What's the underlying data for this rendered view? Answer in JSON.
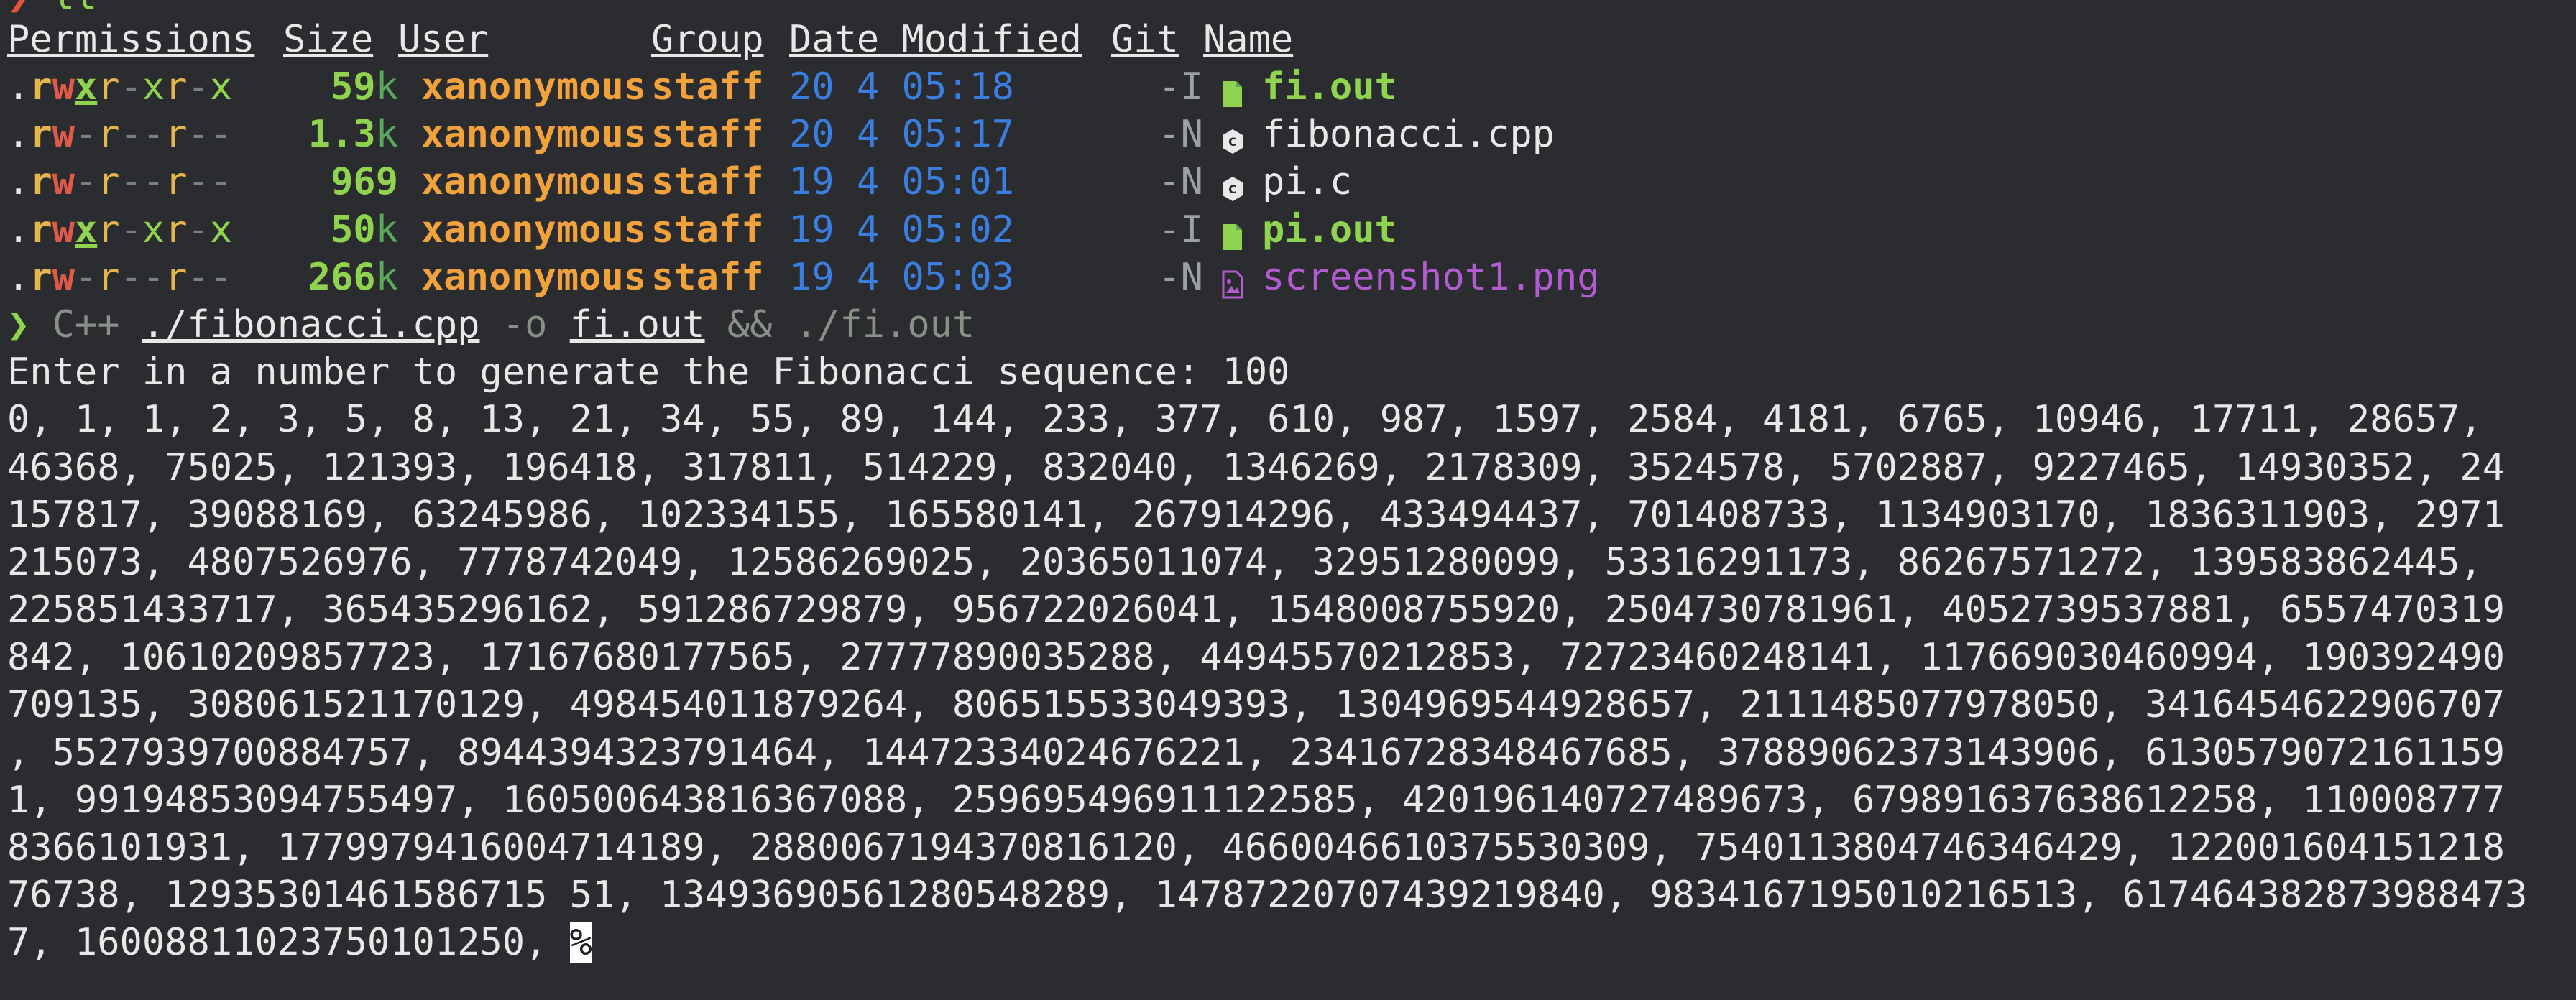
{
  "prompt1": {
    "arrow": "❯",
    "command": "ll"
  },
  "listing": {
    "headers": [
      "Permissions",
      "Size",
      "User",
      "Group",
      "Date Modified",
      "Git",
      "Name"
    ],
    "rows": [
      {
        "perm_dot": ".",
        "perm_r": "r",
        "perm_w": "w",
        "perm_x": "x",
        "perm_rest": "r-xr-x",
        "size_num": "59",
        "size_unit": "k",
        "user": "xanonymous",
        "group": "staff",
        "date": "20 4 05:18",
        "git": "-I",
        "name": "fi.out",
        "kind": "exec",
        "icon": "file-icon"
      },
      {
        "perm_dot": ".",
        "perm_r": "r",
        "perm_w": "w",
        "perm_x": "-",
        "perm_rest": "r--r--",
        "size_num": "1.3",
        "size_unit": "k",
        "user": "xanonymous",
        "group": "staff",
        "date": "20 4 05:17",
        "git": "-N",
        "name": "fibonacci.cpp",
        "kind": "src",
        "icon": "cpp-icon"
      },
      {
        "perm_dot": ".",
        "perm_r": "r",
        "perm_w": "w",
        "perm_x": "-",
        "perm_rest": "r--r--",
        "size_num": "969",
        "size_unit": "",
        "user": "xanonymous",
        "group": "staff",
        "date": "19 4 05:01",
        "git": "-N",
        "name": "pi.c",
        "kind": "src",
        "icon": "c-icon"
      },
      {
        "perm_dot": ".",
        "perm_r": "r",
        "perm_w": "w",
        "perm_x": "x",
        "perm_rest": "r-xr-x",
        "size_num": "50",
        "size_unit": "k",
        "user": "xanonymous",
        "group": "staff",
        "date": "19 4 05:02",
        "git": "-I",
        "name": "pi.out",
        "kind": "exec",
        "icon": "file-icon"
      },
      {
        "perm_dot": ".",
        "perm_r": "r",
        "perm_w": "w",
        "perm_x": "-",
        "perm_rest": "r--r--",
        "size_num": "266",
        "size_unit": "k",
        "user": "xanonymous",
        "group": "staff",
        "date": "19 4 05:03",
        "git": "-N",
        "name": "screenshot1.png",
        "kind": "img",
        "icon": "image-icon"
      }
    ]
  },
  "prompt2": {
    "arrow": "❯",
    "compiler": "C++",
    "src": "./fibonacci.cpp",
    "flag": "-o",
    "out": "fi.out",
    "and": "&&",
    "run": "./fi.out"
  },
  "output": {
    "prompt_line": "Enter in a number to generate the Fibonacci sequence: 100",
    "lines": [
      "0, 1, 1, 2, 3, 5, 8, 13, 21, 34, 55, 89, 144, 233, 377, 610, 987, 1597, 2584, 4181, 6765, 10946, 17711, 28657,",
      "46368, 75025, 121393, 196418, 317811, 514229, 832040, 1346269, 2178309, 3524578, 5702887, 9227465, 14930352, 24",
      "157817, 39088169, 63245986, 102334155, 165580141, 267914296, 433494437, 701408733, 1134903170, 1836311903, 2971",
      "215073, 4807526976, 7778742049, 12586269025, 20365011074, 32951280099, 53316291173, 86267571272, 139583862445,",
      "225851433717, 365435296162, 591286729879, 956722026041, 1548008755920, 2504730781961, 4052739537881, 6557470319",
      "842, 10610209857723, 17167680177565, 27777890035288, 44945570212853, 72723460248141, 117669030460994, 190392490",
      "709135, 308061521170129, 498454011879264, 806515533049393, 1304969544928657, 2111485077978050, 3416454622906707",
      ", 5527939700884757, 8944394323791464, 14472334024676221, 23416728348467685, 37889062373143906, 6130579072161159",
      "1, 99194853094755497, 160500643816367088, 259695496911122585, 420196140727489673, 679891637638612258, 110008777",
      "8366101931, 1779979416004714189, 2880067194370816120, 4660046610375530309, 7540113804746346429, 122001604151218",
      "76738, 12935301461586715 51, 13493690561280548289, 14787220707439219840, 9834167195010216513, 617464382873988473",
      "7, 16008811023750101250, "
    ],
    "cursor_char": "%"
  }
}
